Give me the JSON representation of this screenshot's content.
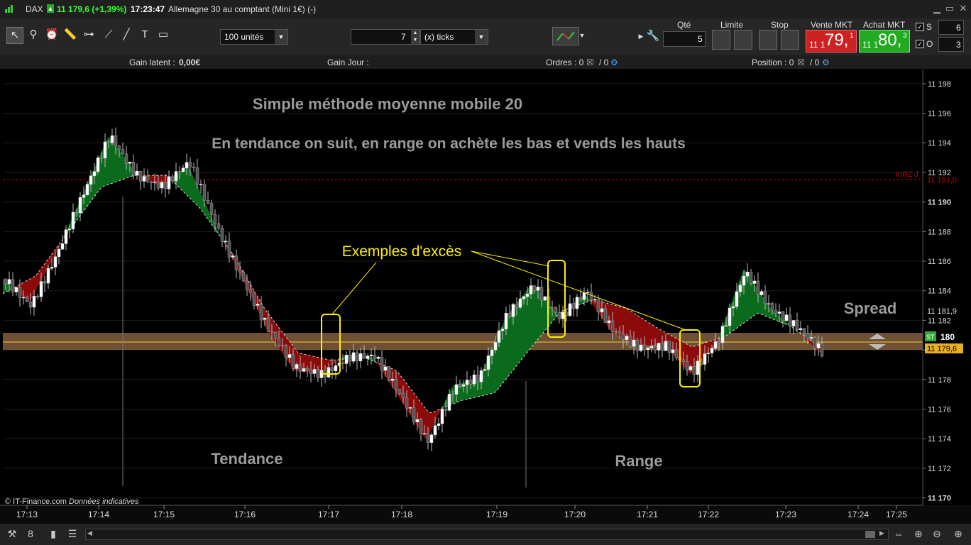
{
  "titlebar": {
    "symbol": "DAX",
    "price_change": "11 179,6 (+1,39%)",
    "time": "17:23:47",
    "instrument": "Allemagne 30 au comptant (Mini 1€) (-)"
  },
  "toolbar": {
    "quantity_select": "100 unités",
    "ticks_value": "7",
    "ticks_unit": "(x) ticks",
    "qty_label": "Qté",
    "qty_value": "5",
    "limit_label": "Limite",
    "stop_label": "Stop",
    "sell_label": "Vente MKT",
    "sell_prefix": "11 1",
    "sell_big": "79,",
    "sell_sup": "1",
    "buy_label": "Achat MKT",
    "buy_prefix": "11 1",
    "buy_big": "80,",
    "buy_sup": "3",
    "s_label": "S",
    "s_value": "6",
    "o_label": "O",
    "o_value": "3"
  },
  "status": {
    "gain_latent_label": "Gain latent :",
    "gain_latent_value": "0,00€",
    "gain_jour_label": "Gain Jour :",
    "ordres": "Ordres : 0",
    "ordres_total": "/ 0",
    "position": "Position : 0",
    "position_total": "/ 0"
  },
  "colors": {
    "bull_fill": "#0b6b1c",
    "bear_fill": "#8b0a0a",
    "candle_up": "#ffffff",
    "candle_down": "#cc3333",
    "spread_band": "#7a5a3a",
    "annotation": "#ffff00",
    "sell_bg": "#cc2222",
    "buy_bg": "#22aa22"
  },
  "annotations": {
    "title": "Simple méthode moyenne mobile 20",
    "subtitle": "En tendance on suit, en range on achète les bas et vends les hauts",
    "excess_label": "Exemples d'excès",
    "tendance": "Tendance",
    "range": "Range",
    "spread": "Spread",
    "copyright": "© IT-Finance.com",
    "data_note": "Données indicatives"
  },
  "price_tags": {
    "mr2_label": "mR2 J",
    "mr2_value": "11 191,0",
    "level_value": "11 181,9",
    "st_label": "ST",
    "st_value": "180",
    "last_value": "11 179,6"
  },
  "chart_data": {
    "type": "candlestick",
    "ylim": [
      11169.5,
      11199
    ],
    "y_ticks": [
      "11 198",
      "11 196",
      "11 194",
      "11 192",
      "11 190",
      "11 188",
      "11 186",
      "11 184",
      "11 182",
      "11 180",
      "11 178",
      "11 176",
      "11 174",
      "11 172",
      "11 170"
    ],
    "y_tick_values": [
      11198,
      11196,
      11194,
      11192,
      11190,
      11188,
      11186,
      11184,
      11182,
      11180,
      11178,
      11176,
      11174,
      11172,
      11170
    ],
    "x_ticks": [
      "17:13",
      "17:14",
      "17:15",
      "17:16",
      "17:17",
      "17:18",
      "17:19",
      "17:20",
      "17:21",
      "17:22",
      "17:23",
      "17:24",
      "17:25"
    ],
    "mr2_level": 11191.0,
    "spread": [
      11179.4,
      11180.6
    ],
    "price_path": [
      [
        11184.8,
        11184.8
      ],
      [
        11183.2,
        11183.2
      ],
      [
        11186.5,
        11186.5
      ],
      [
        11190.4,
        11190.4
      ],
      [
        11194.5,
        11194.5
      ],
      [
        11192.0,
        11192.0
      ],
      [
        11191.0,
        11191.0
      ],
      [
        11192.5,
        11192.5
      ],
      [
        11188.5,
        11188.5
      ],
      [
        11185.0,
        11185.0
      ],
      [
        11181.3,
        11181.3
      ],
      [
        11178.6,
        11178.6
      ],
      [
        11178.4,
        11178.4
      ],
      [
        11179.7,
        11179.7
      ],
      [
        11179.5,
        11179.5
      ],
      [
        11176.7,
        11176.7
      ],
      [
        11173.9,
        11173.9
      ],
      [
        11177.6,
        11177.6
      ],
      [
        11178.1,
        11178.1
      ],
      [
        11182.2,
        11182.2
      ],
      [
        11184.5,
        11184.5
      ],
      [
        11182.3,
        11182.3
      ],
      [
        11183.8,
        11183.8
      ],
      [
        11181.2,
        11181.2
      ],
      [
        11180.3,
        11180.3
      ],
      [
        11180.4,
        11180.4
      ],
      [
        11178.3,
        11178.3
      ],
      [
        11180.6,
        11180.6
      ],
      [
        11185.5,
        11185.5
      ],
      [
        11182.8,
        11182.8
      ],
      [
        11181.3,
        11181.3
      ],
      [
        11179.6,
        11179.6
      ]
    ],
    "ma_path": [
      [
        11183.8,
        11183.8
      ],
      [
        11185.0,
        11185.0
      ],
      [
        11188.0,
        11188.0
      ],
      [
        11191.0,
        11191.0
      ],
      [
        11191.8,
        11191.8
      ],
      [
        11191.8,
        11191.8
      ],
      [
        11189.6,
        11189.6
      ],
      [
        11186.5,
        11186.5
      ],
      [
        11182.7,
        11182.7
      ],
      [
        11179.8,
        11179.8
      ],
      [
        11179.3,
        11179.3
      ],
      [
        11179.5,
        11179.5
      ],
      [
        11178.6,
        11178.6
      ],
      [
        11175.7,
        11175.7
      ],
      [
        11176.6,
        11176.6
      ],
      [
        11177.1,
        11177.1
      ],
      [
        11179.9,
        11179.9
      ],
      [
        11182.6,
        11182.6
      ],
      [
        11183.4,
        11183.4
      ],
      [
        11182.8,
        11182.8
      ],
      [
        11181.4,
        11181.4
      ],
      [
        11180.2,
        11180.2
      ],
      [
        11180.9,
        11180.9
      ],
      [
        11182.5,
        11182.5
      ],
      [
        11181.6,
        11181.6
      ],
      [
        11180.0,
        11180.0
      ]
    ]
  }
}
